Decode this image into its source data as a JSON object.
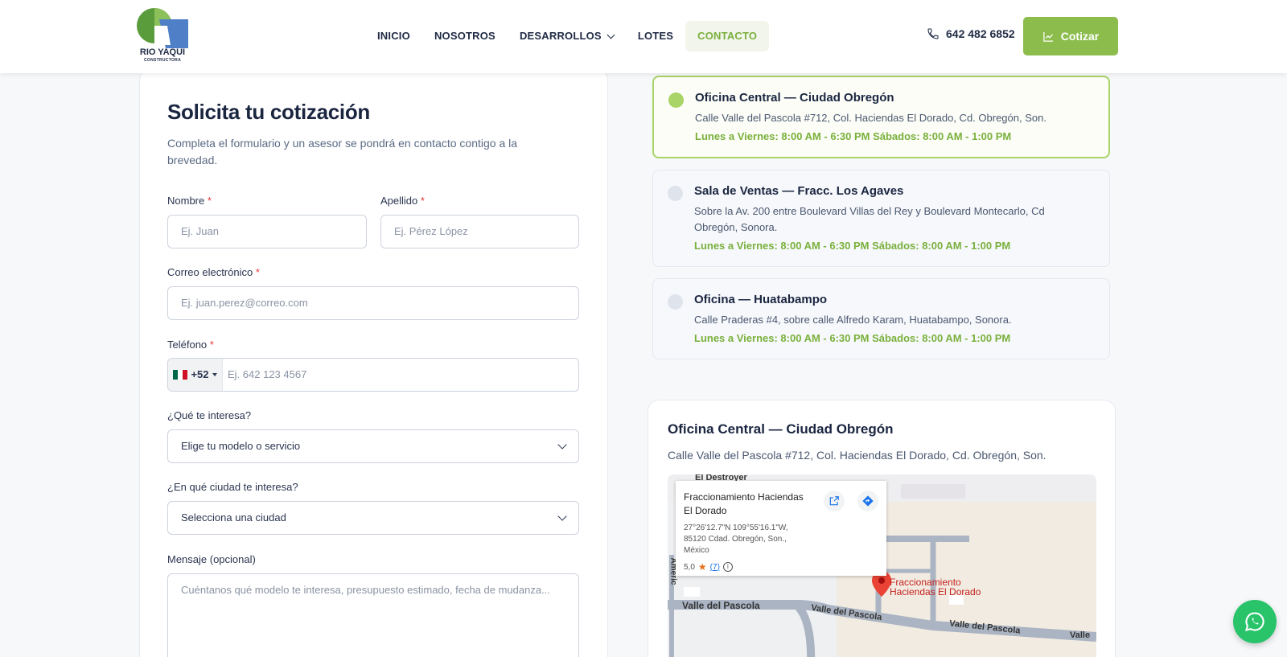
{
  "header": {
    "logo": {
      "title": "RIO YAQUI",
      "subtitle": "CONSTRUCTORA"
    },
    "nav": [
      {
        "label": "INICIO"
      },
      {
        "label": "NOSOTROS"
      },
      {
        "label": "DESARROLLOS"
      },
      {
        "label": "LOTES"
      },
      {
        "label": "CONTACTO",
        "active": true
      }
    ],
    "phone": "642 482 6852",
    "cta_label": "Cotizar"
  },
  "form": {
    "title": "Solicita tu cotización",
    "description": "Completa el formulario y un asesor se pondrá en contacto contigo a la brevedad.",
    "nombre": {
      "label": "Nombre",
      "placeholder": "Ej. Juan"
    },
    "apellido": {
      "label": "Apellido",
      "placeholder": "Ej. Pérez López"
    },
    "correo": {
      "label": "Correo electrónico",
      "placeholder": "Ej. juan.perez@correo.com"
    },
    "telefono": {
      "label": "Teléfono",
      "country_code": "+52",
      "placeholder": "Ej. 642 123 4567"
    },
    "interes": {
      "label": "¿Qué te interesa?",
      "value": "Elige tu modelo o servicio"
    },
    "ciudad": {
      "label": "¿En qué ciudad te interesa?",
      "value": "Selecciona una ciudad"
    },
    "mensaje": {
      "label": "Mensaje (opcional)",
      "placeholder": "Cuéntanos qué modelo te interesa, presupuesto estimado, fecha de mudanza..."
    },
    "required_mark": "*"
  },
  "offices": [
    {
      "title": "Oficina Central — Ciudad Obregón",
      "address": "Calle Valle del Pascola #712, Col. Haciendas El Dorado, Cd. Obregón, Son.",
      "hours": "Lunes a Viernes: 8:00 AM - 6:30 PM Sábados: 8:00 AM - 1:00 PM",
      "active": true
    },
    {
      "title": "Sala de Ventas — Fracc. Los Agaves",
      "address": "Sobre la Av. 200 entre Boulevard Villas del Rey y Boulevard Montecarlo, Cd Obregón, Sonora.",
      "hours": "Lunes a Viernes: 8:00 AM - 6:30 PM Sábados: 8:00 AM - 1:00 PM",
      "active": false
    },
    {
      "title": "Oficina — Huatabampo",
      "address": "Calle Praderas #4, sobre calle Alfredo Karam, Huatabampo, Sonora.",
      "hours": "Lunes a Viernes: 8:00 AM - 6:30 PM Sábados: 8:00 AM - 1:00 PM",
      "active": false
    }
  ],
  "map_card": {
    "title": "Oficina Central — Ciudad Obregón",
    "address": "Calle Valle del Pascola #712, Col. Haciendas El Dorado, Cd. Obregón, Son.",
    "info": {
      "name": "Fraccionamiento Haciendas El Dorado",
      "coords": "27°26'12.7\"N 109°55'16.1\"W, 85120 Cdad. Obregón, Son., México",
      "rating": "5,0",
      "reviews": "(7)"
    },
    "labels": {
      "destroyer": "El Destroyer",
      "street1": "Valle del Pascola",
      "street2": "Valle del Pascola",
      "street3": "Valle del Pascola",
      "street4": "Valle",
      "side": "Americ",
      "pin": "Fraccionamiento Haciendas El Dorado"
    }
  },
  "colors": {
    "accent": "#8cbd4c",
    "navy": "#1a2540",
    "whatsapp": "#29c46a"
  }
}
